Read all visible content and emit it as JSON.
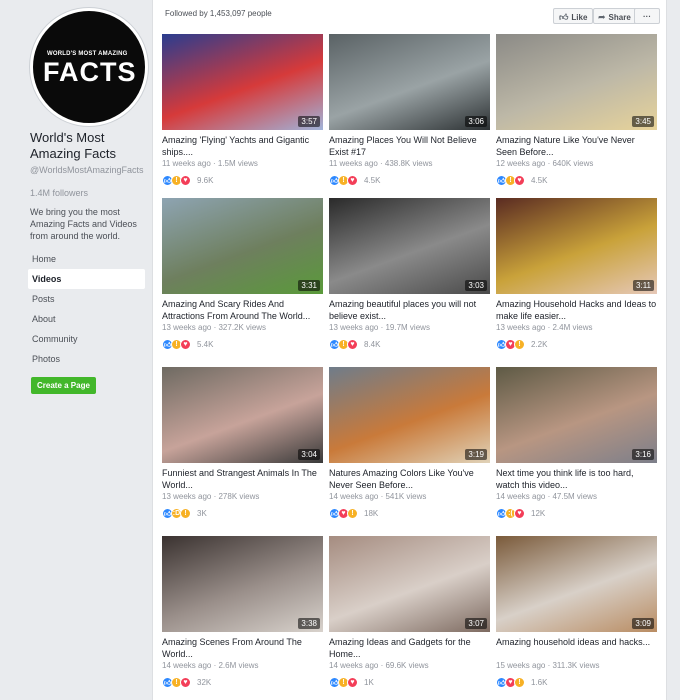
{
  "page": {
    "logo_small": "WORLD'S MOST AMAZING",
    "logo_big": "FACTS",
    "name": "World's Most Amazing Facts",
    "handle": "@WorldsMostAmazingFacts",
    "followers": "1.4M followers",
    "about": "We bring you the most Amazing Facts and Videos from around the world.",
    "create_page_label": "Create a Page"
  },
  "nav": [
    {
      "label": "Home"
    },
    {
      "label": "Videos",
      "active": true
    },
    {
      "label": "Posts"
    },
    {
      "label": "About"
    },
    {
      "label": "Community"
    },
    {
      "label": "Photos"
    }
  ],
  "topbar": {
    "followed_by": "Followed by 1,453,097 people",
    "like_label": "Like",
    "share_label": "Share",
    "more_label": "···"
  },
  "videos": [
    {
      "title": "Amazing 'Flying' Yachts and Gigantic ships....",
      "meta": "11 weeks ago · 1.5M views",
      "count": "9.6K",
      "duration": "3:57",
      "reactions": [
        "like",
        "wow",
        "love"
      ],
      "thumb_colors": [
        "#2a3d8f",
        "#d63a3a",
        "#a1b3d9"
      ]
    },
    {
      "title": "Amazing Places You Will Not Believe Exist #17",
      "meta": "11 weeks ago · 438.8K views",
      "count": "4.5K",
      "duration": "3:06",
      "reactions": [
        "like",
        "wow",
        "love"
      ],
      "thumb_colors": [
        "#5a6265",
        "#9aa3a5",
        "#2c3133"
      ]
    },
    {
      "title": "Amazing Nature Like You've Never Seen Before...",
      "meta": "12 weeks ago · 640K views",
      "count": "4.5K",
      "duration": "3:45",
      "reactions": [
        "like",
        "wow",
        "love"
      ],
      "thumb_colors": [
        "#8b8a86",
        "#bdb8a7",
        "#e7d39a"
      ]
    },
    {
      "title": "Amazing And Scary Rides And Attractions From Around The World...",
      "meta": "13 weeks ago · 327.2K views",
      "count": "5.4K",
      "duration": "3:31",
      "reactions": [
        "like",
        "wow",
        "love"
      ],
      "thumb_colors": [
        "#8ea4b2",
        "#6e7f5e",
        "#5a9a3a"
      ]
    },
    {
      "title": "Amazing beautiful places you will not believe exist...",
      "meta": "13 weeks ago · 19.7M views",
      "count": "8.4K",
      "duration": "3:03",
      "reactions": [
        "like",
        "wow",
        "love"
      ],
      "thumb_colors": [
        "#2a2a2a",
        "#8a8a8a",
        "#4a4a4a"
      ]
    },
    {
      "title": "Amazing Household Hacks and Ideas to make life easier...",
      "meta": "13 weeks ago · 2.4M views",
      "count": "2.2K",
      "duration": "3:11",
      "reactions": [
        "like",
        "love",
        "wow"
      ],
      "thumb_colors": [
        "#5a2b22",
        "#c9a23a",
        "#e6c8b8"
      ]
    },
    {
      "title": "Funniest and Strangest Animals In The World...",
      "meta": "13 weeks ago · 278K views",
      "count": "3K",
      "duration": "3:04",
      "reactions": [
        "like",
        "haha",
        "wow"
      ],
      "thumb_colors": [
        "#6e6a62",
        "#c7a39a",
        "#3a3a3a"
      ]
    },
    {
      "title": "Natures Amazing Colors Like You've Never Seen Before...",
      "meta": "14 weeks ago · 541K views",
      "count": "18K",
      "duration": "3:19",
      "reactions": [
        "like",
        "love",
        "wow"
      ],
      "thumb_colors": [
        "#6f7c8a",
        "#c97a3a",
        "#e0d2b8"
      ]
    },
    {
      "title": "Next time you think life is too hard, watch this video...",
      "meta": "14 weeks ago · 47.5M views",
      "count": "12K",
      "duration": "3:16",
      "reactions": [
        "like",
        "sad",
        "love"
      ],
      "thumb_colors": [
        "#5e5a45",
        "#b89682",
        "#7d7f8a"
      ]
    },
    {
      "title": "Amazing Scenes From Around The World...",
      "meta": "14 weeks ago · 2.6M views",
      "count": "32K",
      "duration": "3:38",
      "reactions": [
        "like",
        "wow",
        "love"
      ],
      "thumb_colors": [
        "#3a3230",
        "#9a8f8a",
        "#d8d2cc"
      ]
    },
    {
      "title": "Amazing Ideas and Gadgets for the Home...",
      "meta": "14 weeks ago · 69.6K views",
      "count": "1K",
      "duration": "3:07",
      "reactions": [
        "like",
        "wow",
        "love"
      ],
      "thumb_colors": [
        "#a58c80",
        "#d9cfc8",
        "#7d6a60"
      ]
    },
    {
      "title": "Amazing household ideas and hacks...",
      "meta": "15 weeks ago · 311.3K views",
      "count": "1.6K",
      "duration": "3:09",
      "reactions": [
        "like",
        "love",
        "wow"
      ],
      "thumb_colors": [
        "#7a5a3a",
        "#d8d0c8",
        "#b98c62"
      ]
    }
  ]
}
